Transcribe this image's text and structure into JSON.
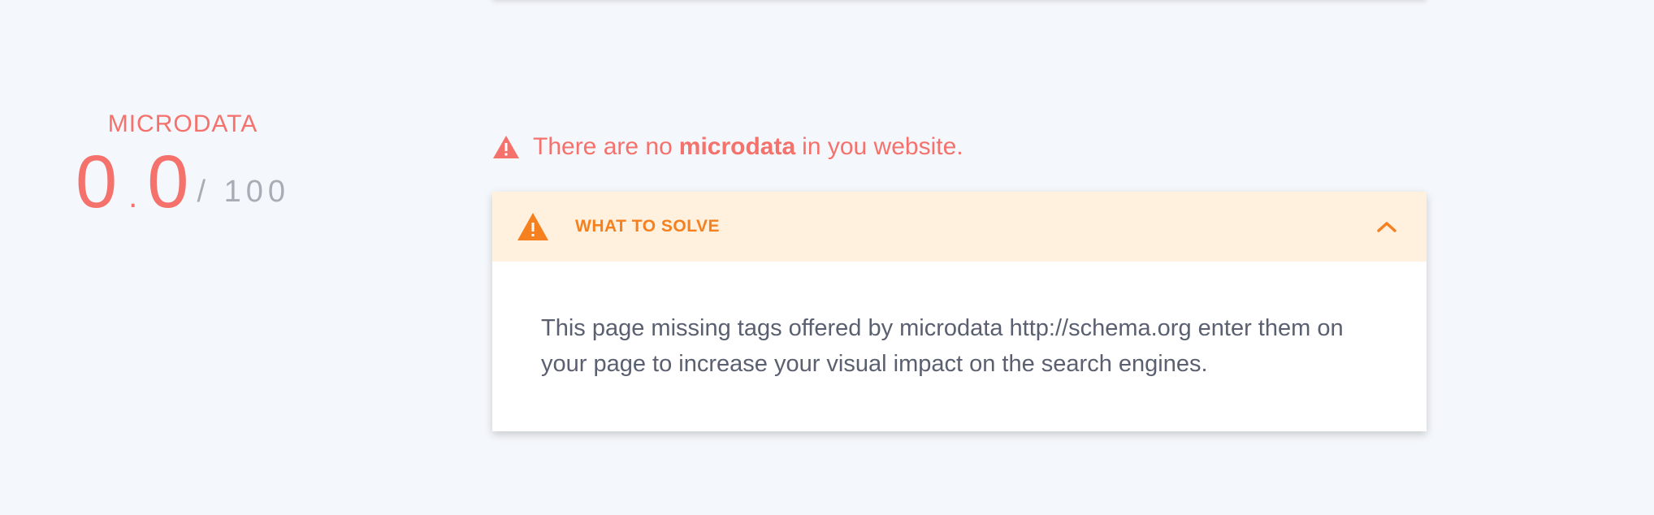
{
  "score": {
    "title": "MICRODATA",
    "integer": "0",
    "dot": ".",
    "decimal": "0",
    "max": "/ 100"
  },
  "alert": {
    "text_before": "There are no",
    "text_strong": "microdata",
    "text_after": "in you website."
  },
  "card": {
    "header_title": "WHAT TO SOLVE",
    "body_text": "This page missing tags offered by microdata http://schema.org enter them on your page to increase your visual impact on the search engines.",
    "icons": {
      "warning": "warning-triangle-icon",
      "toggle": "chevron-up-icon"
    }
  },
  "colors": {
    "error": "#f4716c",
    "warning": "#f5801f",
    "warning_bg": "#fff1de",
    "page_bg": "#f4f7fb"
  }
}
